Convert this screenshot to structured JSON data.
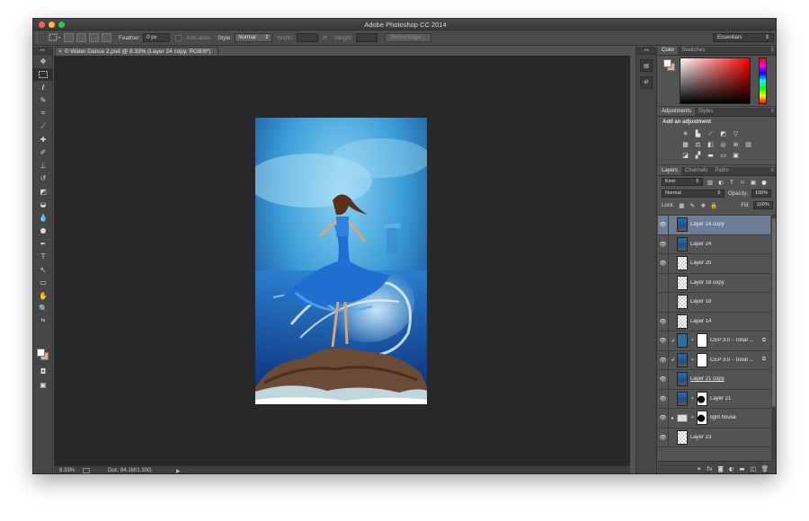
{
  "window": {
    "title": "Adobe Photoshop CC 2014"
  },
  "options_bar": {
    "feather_label": "Feather:",
    "feather_value": "0 px",
    "antialias_label": "Anti-alias",
    "style_label": "Style:",
    "style_value": "Normal",
    "width_label": "Width:",
    "height_label": "Height:",
    "refine_edge_label": "Refine Edge...",
    "workspace_value": "Essentials"
  },
  "document": {
    "tab_close": "×",
    "tab_title": "© Water Dance 2.psd @ 8.33% (Layer 24 copy, RGB/8*)"
  },
  "status_bar": {
    "zoom": "8.33%",
    "doc_info": "Doc: 84.1M/1.30G"
  },
  "dock": {
    "btn1": "▤",
    "btn2": "e!"
  },
  "color_panel": {
    "tabs": [
      "Color",
      "Swatches"
    ],
    "foreground": "#ffffff",
    "background": "#e8a5a0"
  },
  "adjustments_panel": {
    "tabs": [
      "Adjustments",
      "Styles"
    ],
    "title": "Add an adjustment"
  },
  "layers_panel": {
    "tabs": [
      "Layers",
      "Channels",
      "Paths"
    ],
    "kind_label": "Kind",
    "blend_mode": "Normal",
    "opacity_label": "Opacity:",
    "opacity_value": "100%",
    "lock_label": "Lock:",
    "fill_label": "Fill:",
    "fill_value": "100%",
    "layers": [
      {
        "name": "Layer 24 copy",
        "visible": true,
        "selected": true,
        "thumb": "img"
      },
      {
        "name": "Layer 24",
        "visible": true,
        "thumb": "img"
      },
      {
        "name": "Layer 20",
        "visible": true,
        "thumb": "trans"
      },
      {
        "name": "Layer 18 copy",
        "visible": false,
        "thumb": "trans"
      },
      {
        "name": "Layer 18",
        "visible": false,
        "thumb": "trans"
      },
      {
        "name": "Layer 14",
        "visible": true,
        "thumb": "trans"
      },
      {
        "name": "CEP 3.0 - Tonal ...",
        "visible": true,
        "thumb": "adj",
        "mask": "mask",
        "clipped": true,
        "smart": true
      },
      {
        "name": "CEP 3.0 - Tonal ...",
        "visible": true,
        "thumb": "img",
        "mask": "mask",
        "clipped": true,
        "smart": true
      },
      {
        "name": "Layer 21 copy",
        "visible": true,
        "thumb": "img",
        "underline": true
      },
      {
        "name": "Layer 21",
        "visible": true,
        "thumb": "img",
        "mask": "mask-black"
      },
      {
        "name": "light house",
        "visible": true,
        "thumb": "folder",
        "mask": "mask-black",
        "group": true
      },
      {
        "name": "Layer 23",
        "visible": true,
        "thumb": "trans"
      }
    ]
  }
}
